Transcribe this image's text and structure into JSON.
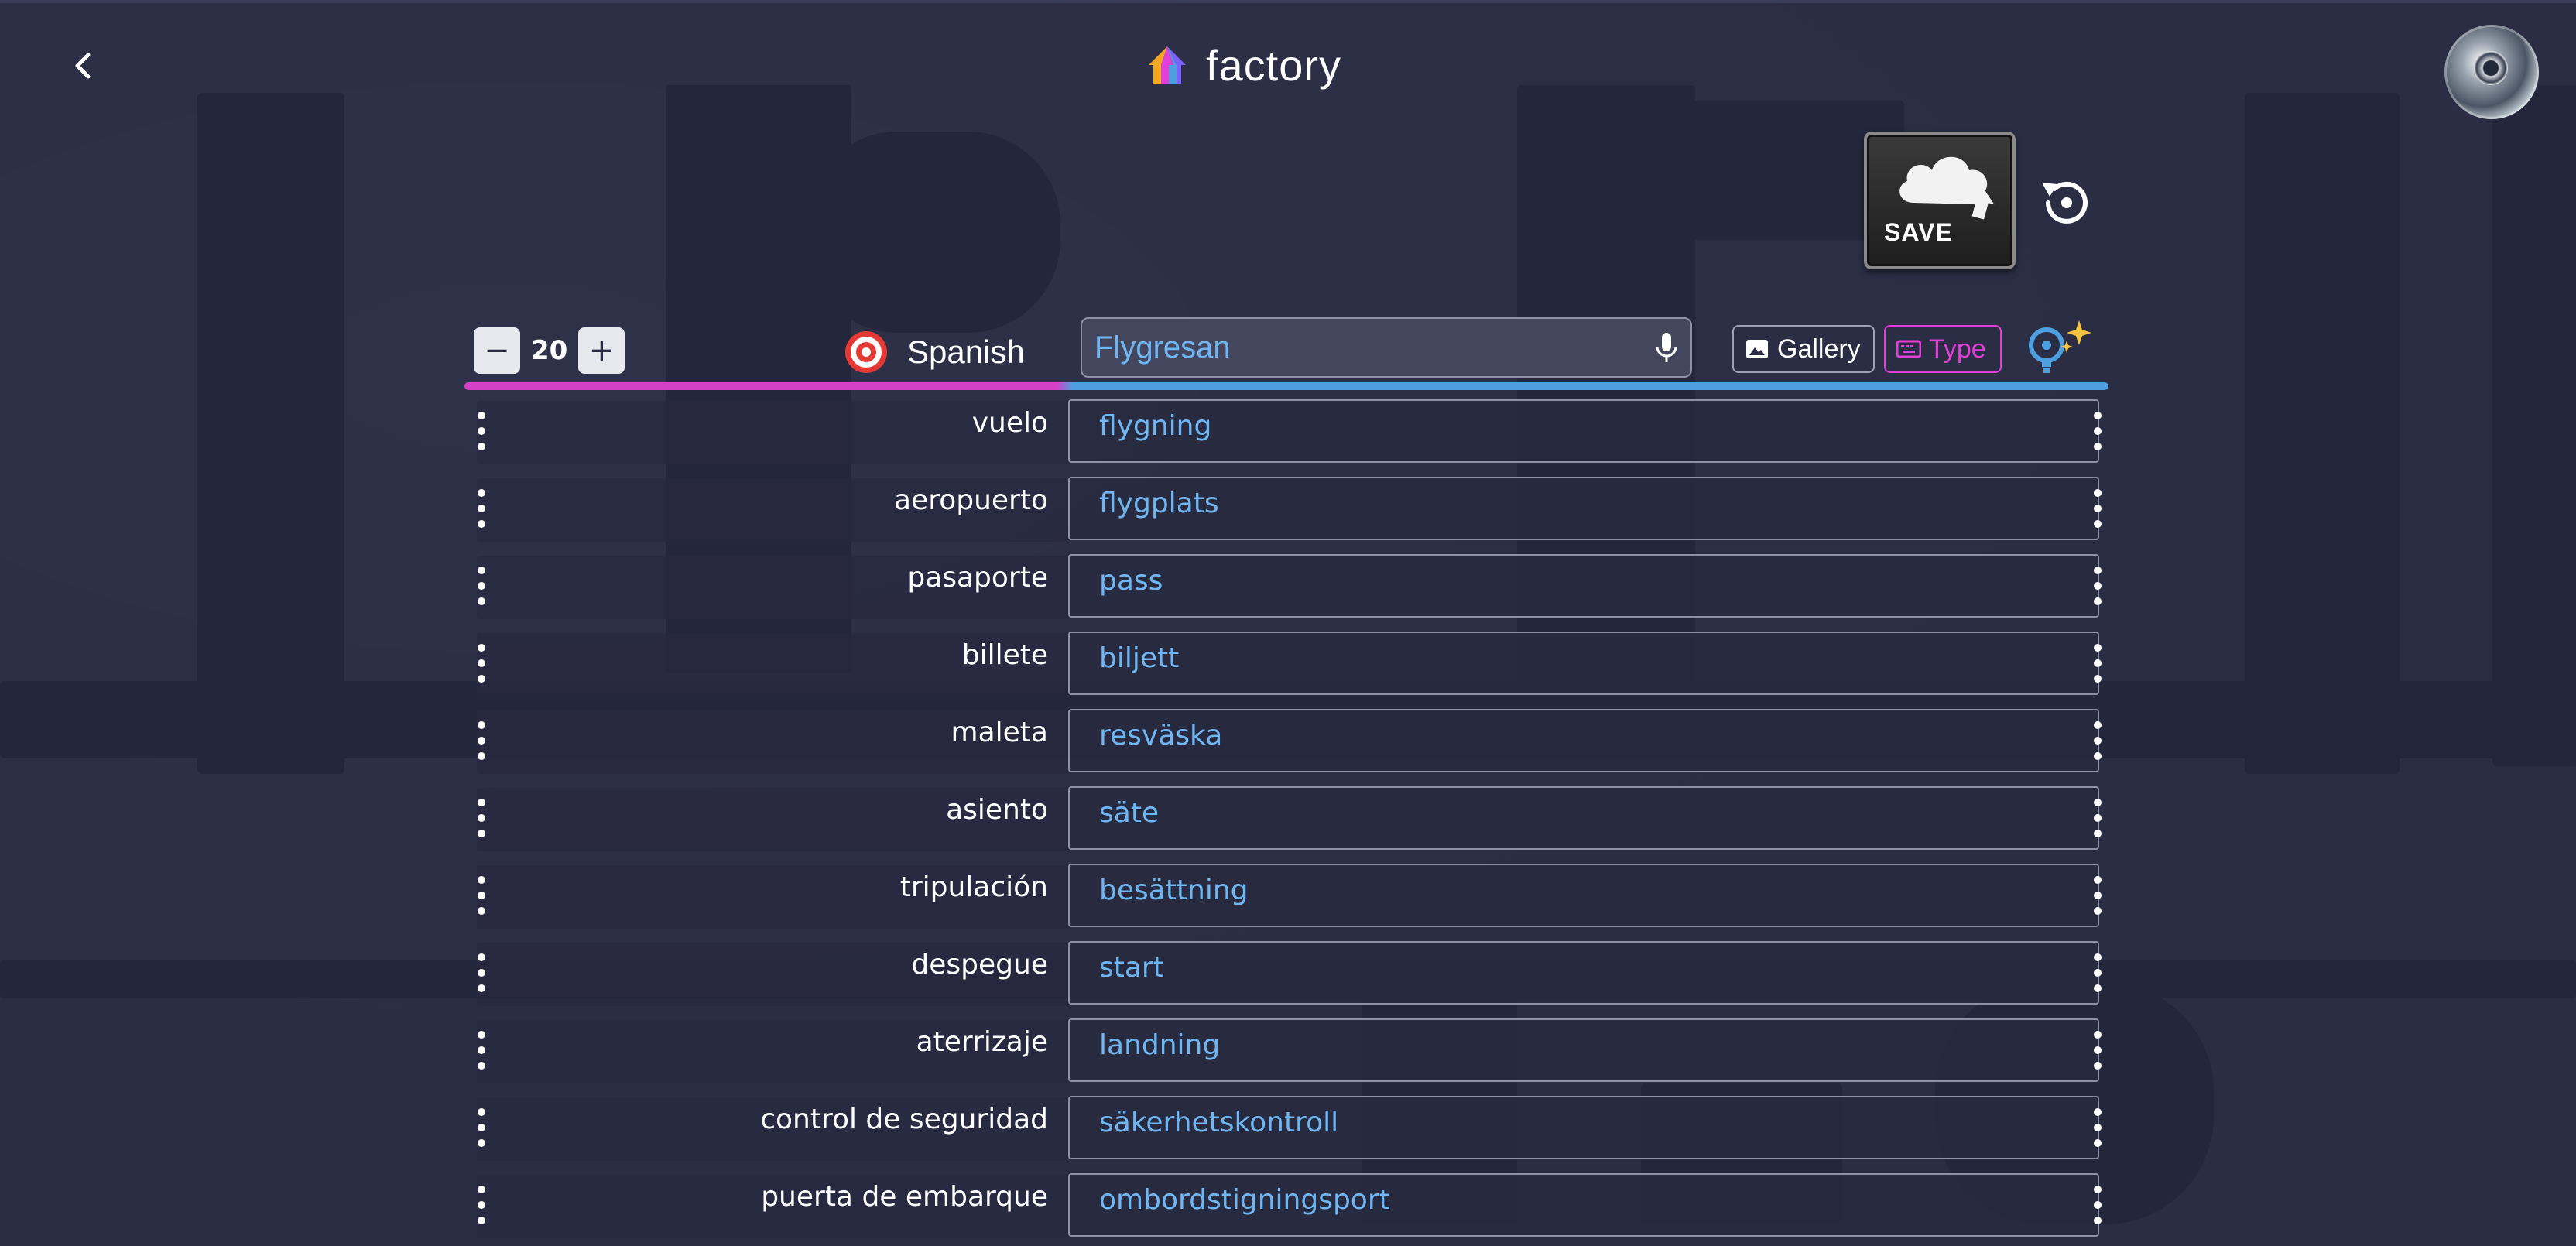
{
  "header": {
    "title": "factory",
    "back_icon": "chevron-left-icon",
    "logo_icon": "rainbow-house-icon",
    "avatar_icon": "robot-avatar"
  },
  "actions": {
    "save_label": "SAVE",
    "reset_icon": "history-reset-icon"
  },
  "toolbar": {
    "count": "20",
    "decrement_label": "−",
    "increment_label": "+",
    "language": "Spanish",
    "language_icon": "target-icon",
    "search_value": "Flygresan",
    "mic_icon": "microphone-icon",
    "gallery_label": "Gallery",
    "type_label": "Type",
    "ai_icon": "lightbulb-sparkle-icon"
  },
  "progress": {
    "value": 0.36,
    "color_left": "#d63fc7",
    "color_right": "#4e9fe0"
  },
  "colors": {
    "background": "#2b2d45",
    "accent_blue": "#6fb6f2",
    "accent_pink": "#e040d8"
  },
  "rows": [
    {
      "source": "vuelo",
      "target": "flygning"
    },
    {
      "source": "aeropuerto",
      "target": "flygplats"
    },
    {
      "source": "pasaporte",
      "target": "pass"
    },
    {
      "source": "billete",
      "target": "biljett"
    },
    {
      "source": "maleta",
      "target": "resväska"
    },
    {
      "source": "asiento",
      "target": "säte"
    },
    {
      "source": "tripulación",
      "target": "besättning"
    },
    {
      "source": "despegue",
      "target": "start"
    },
    {
      "source": "aterrizaje",
      "target": "landning"
    },
    {
      "source": "control de seguridad",
      "target": "säkerhetskontroll"
    },
    {
      "source": "puerta de embarque",
      "target": "ombordstigningsport"
    }
  ]
}
